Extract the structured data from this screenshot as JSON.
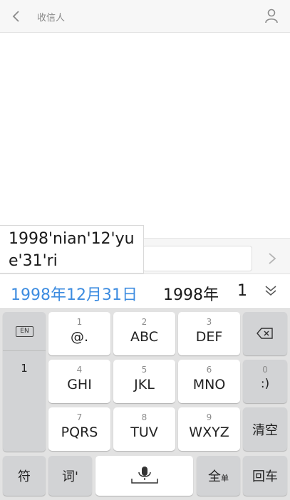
{
  "topbar": {
    "title": "收信人",
    "back_icon": "chevron-left-icon",
    "person_icon": "person-icon"
  },
  "pinyin_popup": {
    "text": "1998'nian'12'yue'31'ri"
  },
  "candidates": [
    "1998年12月31日",
    "1998年",
    "1"
  ],
  "candidate_colors": {
    "primary": "#3d8ce0"
  },
  "keyboard": {
    "en_label": "EN",
    "left_list_item": "1",
    "keys": [
      {
        "num": "1",
        "label": "@."
      },
      {
        "num": "2",
        "label": "ABC"
      },
      {
        "num": "3",
        "label": "DEF"
      },
      {
        "num": "4",
        "label": "GHI"
      },
      {
        "num": "5",
        "label": "JKL"
      },
      {
        "num": "6",
        "label": "MNO"
      },
      {
        "num": "7",
        "label": "PQRS"
      },
      {
        "num": "8",
        "label": "TUV"
      },
      {
        "num": "9",
        "label": "WXYZ"
      }
    ],
    "zero_key": {
      "num": "0",
      "label": ":)"
    },
    "clear_label": "清空",
    "symbol_label": "符",
    "word_label": "词'",
    "fullwidth_label": "全",
    "fullwidth_sub": "单",
    "enter_label": "回车"
  }
}
